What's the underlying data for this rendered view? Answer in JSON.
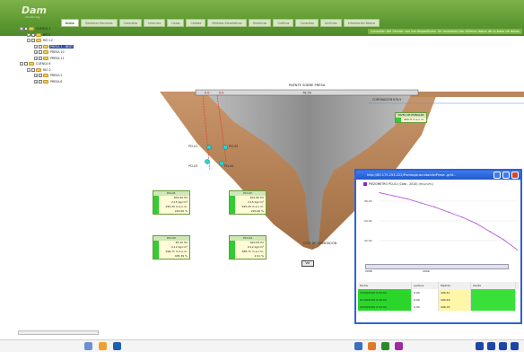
{
  "app": {
    "logo": "Dam",
    "logo_sub": "monitoring"
  },
  "tabs": [
    "Ínicio",
    "Gestionar Recursos",
    "Consultas",
    "Informes",
    "Listas",
    "Calidad",
    "Medidas Estadísticas",
    "Históricas",
    "Gráficas",
    "Consultas",
    "Archivos",
    "Información Básica"
  ],
  "headline": "Conexión del Sensor con los dispositivos. Se muestran los últimos datos de la base de datos",
  "tree": [
    {
      "label": "CUENCA 1",
      "level": 0,
      "sel": false
    },
    {
      "label": "RIO 1",
      "level": 1,
      "sel": false
    },
    {
      "label": "RIO 12",
      "level": 1,
      "sel": false
    },
    {
      "label": "PRESA 1 - NEST",
      "level": 2,
      "sel": true
    },
    {
      "label": "PRESA 10",
      "level": 2,
      "sel": false
    },
    {
      "label": "PRESA 11",
      "level": 2,
      "sel": false
    },
    {
      "label": "CUENCA 6",
      "level": 0,
      "sel": false
    },
    {
      "label": "RIO 2",
      "level": 1,
      "sel": false
    },
    {
      "label": "PRESA 2",
      "level": 2,
      "sel": false
    },
    {
      "label": "PRESA 6",
      "level": 2,
      "sel": false
    }
  ],
  "dam": {
    "crest_label": "PUENTE SOBRE PRESA",
    "crest_value": "76.50",
    "marker_left": "0.0",
    "marker_right": "0.0",
    "coronacion_label": "CORONACIÓN 676.5",
    "nivel_title": "NIVEL DE EMBALSE",
    "nivel_value": "665.8 m.s.n.m.",
    "cota_label": "COTA DE CIMENTACIÓN",
    "button_label": "Ver",
    "sensor_labels": [
      "PCI-01",
      "PCI-02",
      "PCI-03",
      "PCI-04"
    ]
  },
  "sensors": [
    {
      "title": "PCI-01",
      "values": [
        "601,60 Hz",
        "2,15 kg/cm²",
        "495,20 m.s.n.m.",
        "220,00 %"
      ]
    },
    {
      "title": "PCI-02",
      "values": [
        "601,60 Hz",
        "2,15 kg/cm²",
        "495,20 m.s.n.m.",
        "220,00 %"
      ]
    },
    {
      "title": "PCI-03",
      "values": [
        "65,10 Hz",
        "0,12 kg/cm²",
        "498,71 m.s.n.m.",
        "405,39 %"
      ]
    },
    {
      "title": "PCI-04",
      "values": [
        "620,09 Hz",
        "0,12 kg/cm²",
        "488,71 m.s.n.m.",
        "2,51 %"
      ]
    }
  ],
  "popup": {
    "title": "http://83.175.253.222/Puntos/auscultaciónPresa .grid...",
    "legend": "PIEZÓMETRO PCI-01 (Cota - 2010) (m.s.n.m.)",
    "x_ticks": [
      "2008",
      "2009"
    ],
    "table_headers": [
      "Fecha",
      "Lectura",
      "Medida",
      "Alerta"
    ],
    "table_rows": [
      [
        "30/09/2010 0:00:00",
        "0,00",
        "496,51",
        ""
      ],
      [
        "01/09/2010 0:00:00",
        "0,00",
        "496,46",
        ""
      ],
      [
        "02/09/2010 0:00:00",
        "0,00",
        "496,35",
        ""
      ]
    ]
  },
  "chart_data": {
    "type": "line",
    "title": "",
    "series": [
      {
        "name": "PIEZÓMETRO PCI-01 (Cota - 2010) (m.s.n.m.)",
        "values": [
          98,
          96.5,
          95,
          93,
          91,
          88.5,
          86,
          83,
          79,
          75,
          70
        ]
      }
    ],
    "x": [
      "2008",
      "",
      "",
      "",
      "",
      "2009",
      "",
      "",
      "",
      "",
      ""
    ],
    "y_ticks": [
      "96,00",
      "94,00",
      "92,00"
    ],
    "ylim": [
      65,
      100
    ],
    "grid": true,
    "color": "#b24ad6"
  },
  "colors": {
    "accent": "#5d9a32",
    "alert_green": "#33cc33",
    "popup_blue": "#2f63d6"
  }
}
